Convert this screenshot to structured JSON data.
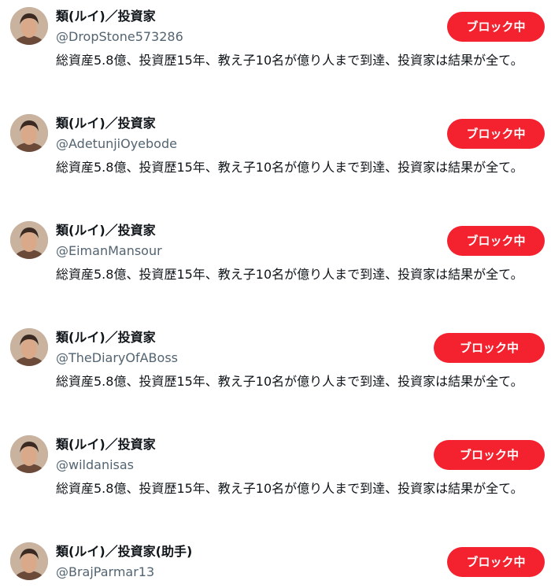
{
  "accounts": [
    {
      "display_name": "類(ルイ)／投資家",
      "handle": "@DropStone573286",
      "bio": "総資産5.8億、投資歴15年、教え子10名が億り人まで到達、投資家は結果が全て。",
      "button_label": "ブロック中"
    },
    {
      "display_name": "類(ルイ)／投資家",
      "handle": "@AdetunjiOyebode",
      "bio": "総資産5.8億、投資歴15年、教え子10名が億り人まで到達、投資家は結果が全て。",
      "button_label": "ブロック中"
    },
    {
      "display_name": "類(ルイ)／投資家",
      "handle": "@EimanMansour",
      "bio": "総資産5.8億、投資歴15年、教え子10名が億り人まで到達、投資家は結果が全て。",
      "button_label": "ブロック中"
    },
    {
      "display_name": "類(ルイ)／投資家",
      "handle": "@TheDiaryOfABoss",
      "bio": "総資産5.8億、投資歴15年、教え子10名が億り人まで到達、投資家は結果が全て。",
      "button_label": "ブロック中"
    },
    {
      "display_name": "類(ルイ)／投資家",
      "handle": "@wildanisas",
      "bio": "総資産5.8億、投資歴15年、教え子10名が億り人まで到達、投資家は結果が全て。",
      "button_label": "ブロック中"
    },
    {
      "display_name": "類(ルイ)／投資家(助手)",
      "handle": "@BrajParmar13",
      "bio": "",
      "button_label": "ブロック中"
    }
  ],
  "colors": {
    "block_button": "#f4212e",
    "handle_text": "#536471",
    "primary_text": "#0f1419"
  }
}
